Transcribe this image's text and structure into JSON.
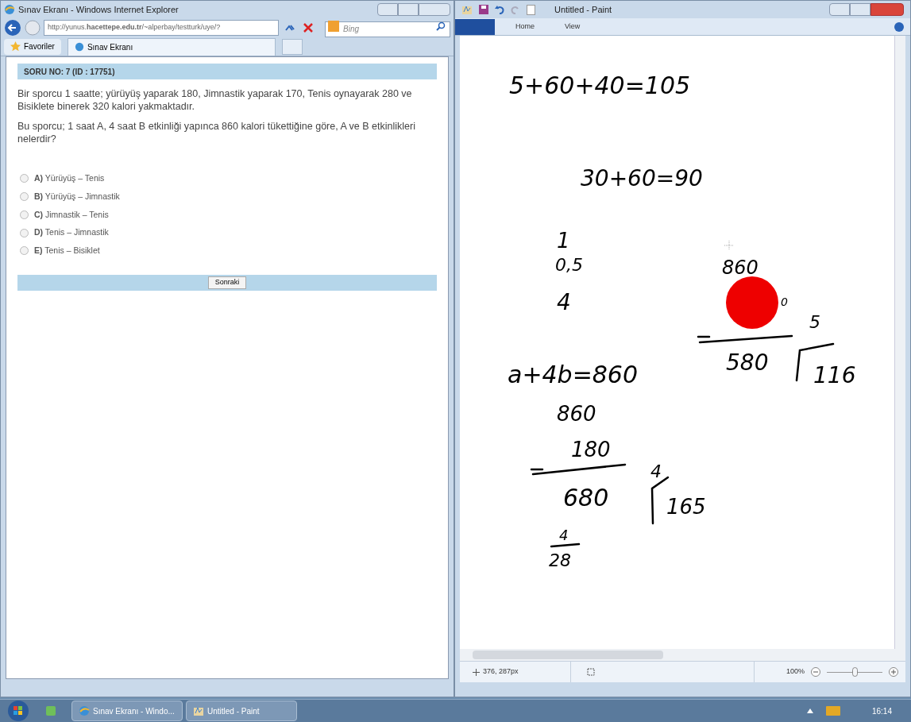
{
  "browser": {
    "title": "Sınav Ekranı - Windows Internet Explorer",
    "address": "http://yunus.**hacettepe.edu.tr**/~alperbay/testturk/uye/?",
    "search": {
      "placeholder": "Bing"
    },
    "favorites": "Favoriler",
    "tab": "Sınav Ekranı",
    "question": {
      "header": "SORU NO: 7 (ID : 17751)",
      "paragraphs": [
        "Bir sporcu 1 saatte; yürüyüş yaparak 180, Jimnastik yaparak 170, Tenis oynayarak 280 ve Bisiklete binerek 320 kalori yakmaktadır.",
        "Bu sporcu; 1 saat A, 4 saat B etkinliği yapınca 860 kalori tükettiğine göre, A ve B etkinlikleri nelerdir?"
      ],
      "options": [
        {
          "label": "**A)** Yürüyüş – Tenis",
          "selected": false
        },
        {
          "label": "**B)** Yürüyüş – Jimnastik",
          "selected": false
        },
        {
          "label": "**C)** Jimnastik – Tenis",
          "selected": false
        },
        {
          "label": "**D)** Tenis – Jimnastik",
          "selected": false
        },
        {
          "label": "**E)** Tenis – Bisiklet",
          "selected": false
        }
      ],
      "next_button": "Sonraki"
    }
  },
  "paint": {
    "title": "Untitled - Paint",
    "ribbon_tabs": [
      "Home",
      "View"
    ],
    "handwriting": [
      "5+60+40=105",
      "30+60=90",
      "1",
      "0,5",
      "860",
      "4",
      "0",
      "5",
      "a+4b=860",
      "580",
      "116",
      "860",
      "180",
      "4",
      "680",
      "165",
      "4",
      "28"
    ],
    "status": {
      "position": "376, 287px",
      "zoom": "100%",
      "zoom_slider": {
        "level": 0.5
      }
    }
  },
  "taskbar": {
    "items": [
      {
        "label": "Sınav Ekranı - Windo...",
        "kind": "browser"
      },
      {
        "label": "Untitled - Paint",
        "kind": "paint"
      }
    ],
    "clock": "16:14"
  }
}
